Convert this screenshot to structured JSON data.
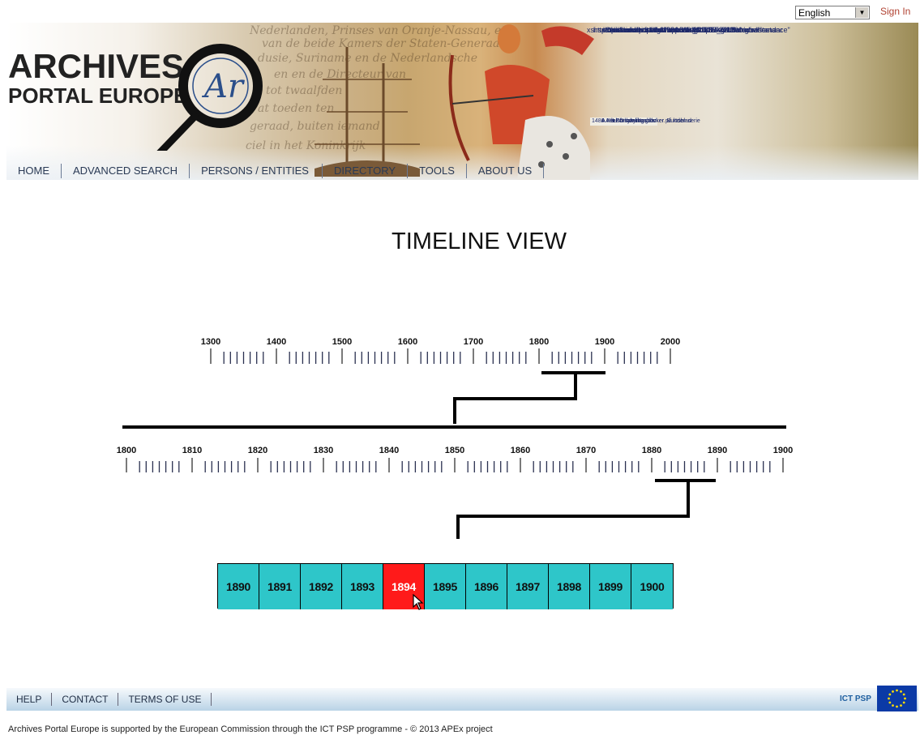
{
  "header": {
    "language": "English",
    "sign_in": "Sign In",
    "logo_line1": "ARCHIVES",
    "logo_line2": "PORTAL EUROPE",
    "logo_monogram": "Ar",
    "banner_xml_lines": [
      "<?xml version=\"1.0\" encoding=\"UTF-8\" ?>",
      "- <ead xmlns:xlink=\"http://www.w3.org/1999/xlink\"",
      "xmlns:xsi=\"http://www.w3.org/2001/XMLSchema-instance\"",
      "xmlns=\"urn:isbn:1-931666-22-9\"",
      "xsi:schemaLocation=\"urn:isbn:1-931666-22-9",
      "http://archivesportaleurope.eu/APEnet_validator/schema",
      "http://www.w3.org/1999/xlink http://www.loc.gov/standar",
      "audience=\"external\">"
    ],
    "banner_tree_lines": [
      "1486 Adelsö kykyrkoarkiv",
      "A I Husförhörslängder",
      "A II a Församlingsböcker. Bunden serie",
      "A II b Församlingsböcker på lösblad"
    ]
  },
  "nav": {
    "items": [
      "HOME",
      "ADVANCED SEARCH",
      "PERSONS / ENTITIES",
      "DIRECTORY",
      "TOOLS",
      "ABOUT US"
    ]
  },
  "page_title": "TIMELINE VIEW",
  "timeline": {
    "centuries": [
      "1300",
      "1400",
      "1500",
      "1600",
      "1700",
      "1800",
      "1900",
      "2000"
    ],
    "decades": [
      "1800",
      "1810",
      "1820",
      "1830",
      "1840",
      "1850",
      "1860",
      "1870",
      "1880",
      "1890",
      "1900"
    ],
    "years": [
      "1890",
      "1891",
      "1892",
      "1893",
      "1894",
      "1895",
      "1896",
      "1897",
      "1898",
      "1899",
      "1900"
    ],
    "selected_year": "1894"
  },
  "footer": {
    "links": [
      "HELP",
      "CONTACT",
      "TERMS OF USE"
    ],
    "ict_label": "ICT PSP",
    "note": "Archives Portal Europe is supported by the European Commission through the ICT PSP programme - © 2013 APEx project"
  },
  "colors": {
    "year_box": "#2ec6c9",
    "year_selected": "#ff1a1a",
    "sign_in": "#b04030"
  }
}
